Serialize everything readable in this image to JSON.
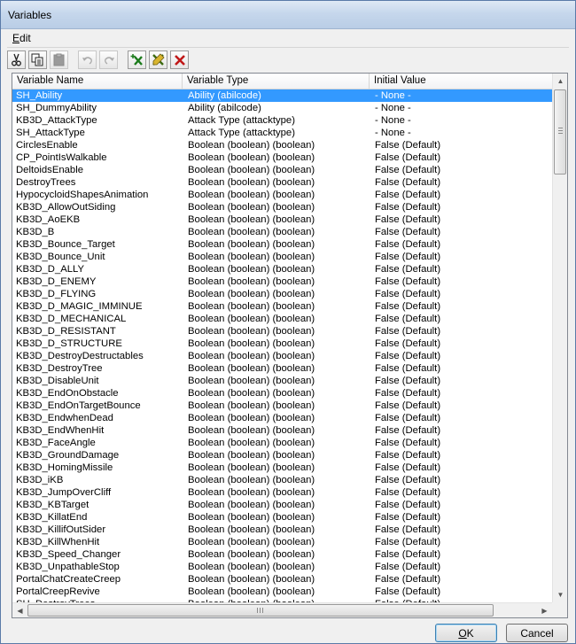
{
  "window": {
    "title": "Variables"
  },
  "menu": {
    "edit_label": "Edit"
  },
  "toolbar": {
    "buttons": [
      {
        "icon": "cut-icon",
        "enabled": true
      },
      {
        "icon": "copy-icon",
        "enabled": true
      },
      {
        "icon": "paste-icon",
        "enabled": false
      },
      {
        "icon": "undo-icon",
        "enabled": false
      },
      {
        "icon": "redo-icon",
        "enabled": false
      },
      {
        "icon": "new-variable-icon",
        "enabled": true
      },
      {
        "icon": "edit-variable-icon",
        "enabled": true
      },
      {
        "icon": "delete-icon",
        "enabled": true
      }
    ]
  },
  "list": {
    "columns": [
      "Variable Name",
      "Variable Type",
      "Initial Value"
    ],
    "selected_index": 0,
    "rows": [
      [
        "SH_Ability",
        "Ability (abilcode)",
        "- None -"
      ],
      [
        "SH_DummyAbility",
        "Ability (abilcode)",
        "- None -"
      ],
      [
        "KB3D_AttackType",
        "Attack Type (attacktype)",
        "- None -"
      ],
      [
        "SH_AttackType",
        "Attack Type (attacktype)",
        "- None -"
      ],
      [
        "CirclesEnable",
        "Boolean (boolean) (boolean)",
        "False (Default)"
      ],
      [
        "CP_PointIsWalkable",
        "Boolean (boolean) (boolean)",
        "False (Default)"
      ],
      [
        "DeltoidsEnable",
        "Boolean (boolean) (boolean)",
        "False (Default)"
      ],
      [
        "DestroyTrees",
        "Boolean (boolean) (boolean)",
        "False (Default)"
      ],
      [
        "HypocycloidShapesAnimation",
        "Boolean (boolean) (boolean)",
        "False (Default)"
      ],
      [
        "KB3D_AllowOutSiding",
        "Boolean (boolean) (boolean)",
        "False (Default)"
      ],
      [
        "KB3D_AoEKB",
        "Boolean (boolean) (boolean)",
        "False (Default)"
      ],
      [
        "KB3D_B",
        "Boolean (boolean) (boolean)",
        "False (Default)"
      ],
      [
        "KB3D_Bounce_Target",
        "Boolean (boolean) (boolean)",
        "False (Default)"
      ],
      [
        "KB3D_Bounce_Unit",
        "Boolean (boolean) (boolean)",
        "False (Default)"
      ],
      [
        "KB3D_D_ALLY",
        "Boolean (boolean) (boolean)",
        "False (Default)"
      ],
      [
        "KB3D_D_ENEMY",
        "Boolean (boolean) (boolean)",
        "False (Default)"
      ],
      [
        "KB3D_D_FLYING",
        "Boolean (boolean) (boolean)",
        "False (Default)"
      ],
      [
        "KB3D_D_MAGIC_IMMINUE",
        "Boolean (boolean) (boolean)",
        "False (Default)"
      ],
      [
        "KB3D_D_MECHANICAL",
        "Boolean (boolean) (boolean)",
        "False (Default)"
      ],
      [
        "KB3D_D_RESISTANT",
        "Boolean (boolean) (boolean)",
        "False (Default)"
      ],
      [
        "KB3D_D_STRUCTURE",
        "Boolean (boolean) (boolean)",
        "False (Default)"
      ],
      [
        "KB3D_DestroyDestructables",
        "Boolean (boolean) (boolean)",
        "False (Default)"
      ],
      [
        "KB3D_DestroyTree",
        "Boolean (boolean) (boolean)",
        "False (Default)"
      ],
      [
        "KB3D_DisableUnit",
        "Boolean (boolean) (boolean)",
        "False (Default)"
      ],
      [
        "KB3D_EndOnObstacle",
        "Boolean (boolean) (boolean)",
        "False (Default)"
      ],
      [
        "KB3D_EndOnTargetBounce",
        "Boolean (boolean) (boolean)",
        "False (Default)"
      ],
      [
        "KB3D_EndwhenDead",
        "Boolean (boolean) (boolean)",
        "False (Default)"
      ],
      [
        "KB3D_EndWhenHit",
        "Boolean (boolean) (boolean)",
        "False (Default)"
      ],
      [
        "KB3D_FaceAngle",
        "Boolean (boolean) (boolean)",
        "False (Default)"
      ],
      [
        "KB3D_GroundDamage",
        "Boolean (boolean) (boolean)",
        "False (Default)"
      ],
      [
        "KB3D_HomingMissile",
        "Boolean (boolean) (boolean)",
        "False (Default)"
      ],
      [
        "KB3D_iKB",
        "Boolean (boolean) (boolean)",
        "False (Default)"
      ],
      [
        "KB3D_JumpOverCliff",
        "Boolean (boolean) (boolean)",
        "False (Default)"
      ],
      [
        "KB3D_KBTarget",
        "Boolean (boolean) (boolean)",
        "False (Default)"
      ],
      [
        "KB3D_KillatEnd",
        "Boolean (boolean) (boolean)",
        "False (Default)"
      ],
      [
        "KB3D_KillifOutSider",
        "Boolean (boolean) (boolean)",
        "False (Default)"
      ],
      [
        "KB3D_KillWhenHit",
        "Boolean (boolean) (boolean)",
        "False (Default)"
      ],
      [
        "KB3D_Speed_Changer",
        "Boolean (boolean) (boolean)",
        "False (Default)"
      ],
      [
        "KB3D_UnpathableStop",
        "Boolean (boolean) (boolean)",
        "False (Default)"
      ],
      [
        "PortalChatCreateCreep",
        "Boolean (boolean) (boolean)",
        "False (Default)"
      ],
      [
        "PortalCreepRevive",
        "Boolean (boolean) (boolean)",
        "False (Default)"
      ],
      [
        "SH_DestroyTrees",
        "Boolean (boolean) (boolean)",
        "False (Default)"
      ]
    ]
  },
  "buttons": {
    "ok_label": "OK",
    "cancel_label": "Cancel"
  }
}
